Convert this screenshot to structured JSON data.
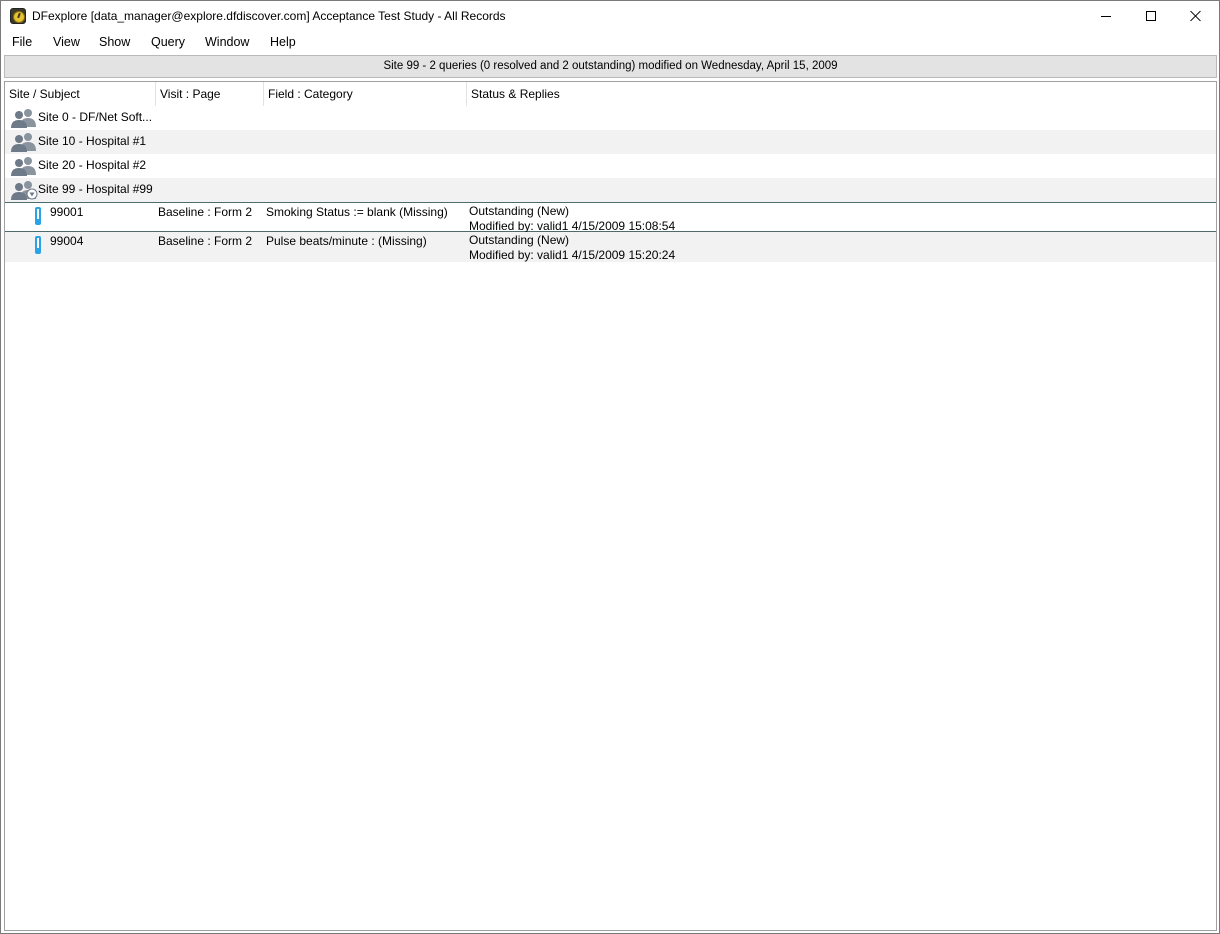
{
  "window": {
    "title": "DFexplore [data_manager@explore.dfdiscover.com] Acceptance Test Study - All Records"
  },
  "menu": [
    "File",
    "View",
    "Show",
    "Query",
    "Window",
    "Help"
  ],
  "status_strip": "Site 99 - 2 queries (0 resolved and 2 outstanding) modified on Wednesday, April 15, 2009",
  "columns": [
    "Site / Subject",
    "Visit : Page",
    "Field : Category",
    "Status & Replies"
  ],
  "sites": [
    {
      "label": "Site 0 - DF/Net Soft..."
    },
    {
      "label": "Site 10 - Hospital #1"
    },
    {
      "label": "Site 20 - Hospital #2"
    },
    {
      "label": "Site 99 - Hospital #99"
    }
  ],
  "queries": [
    {
      "subject": "99001",
      "visit": "Baseline : Form 2",
      "field": "Smoking Status := blank (Missing)",
      "status": "Outstanding (New)",
      "modified": "Modified by: valid1 4/15/2009 15:08:54"
    },
    {
      "subject": "99004",
      "visit": "Baseline : Form 2",
      "field": "Pulse beats/minute : (Missing)",
      "status": "Outstanding (New)",
      "modified": "Modified by: valid1 4/15/2009 15:20:24"
    }
  ],
  "colors": {
    "icon_gray": "#7a8592",
    "query_blue": "#2aa2e8",
    "alt_row": "#f2f2f2",
    "selection_border": "#4d6b6b"
  }
}
